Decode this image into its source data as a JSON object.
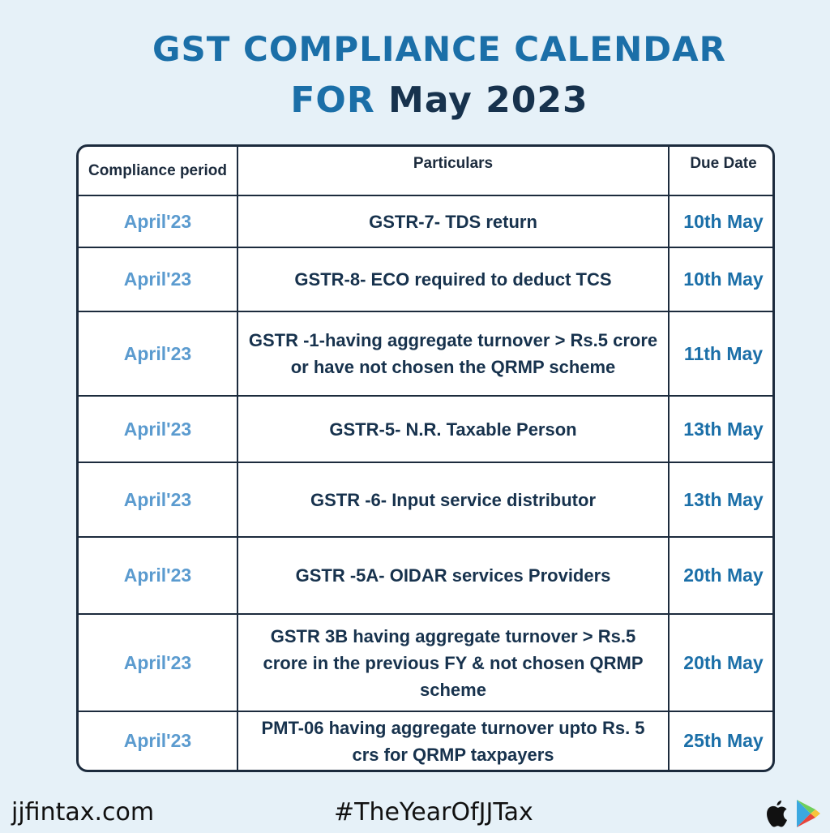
{
  "title": {
    "line1": "GST COMPLIANCE CALENDAR",
    "line2_prefix": "FOR",
    "line2_month": "May 2023"
  },
  "table": {
    "headers": {
      "period": "Compliance period",
      "particulars": "Particulars",
      "due_date": "Due Date"
    },
    "rows": [
      {
        "period": "April'23",
        "particulars": "GSTR-7- TDS return",
        "due": "10th May"
      },
      {
        "period": "April'23",
        "particulars": "GSTR-8- ECO required to deduct TCS",
        "due": "10th May"
      },
      {
        "period": "April'23",
        "particulars": "GSTR -1-having aggregate turnover > Rs.5 crore or have not chosen the QRMP scheme",
        "due": "11th May"
      },
      {
        "period": "April'23",
        "particulars": "GSTR-5- N.R. Taxable Person",
        "due": "13th May"
      },
      {
        "period": "April'23",
        "particulars": "GSTR -6- Input service distributor",
        "due": "13th May"
      },
      {
        "period": "April'23",
        "particulars": "GSTR -5A- OIDAR services Providers",
        "due": "20th May"
      },
      {
        "period": "April'23",
        "particulars": "GSTR 3B having aggregate turnover > Rs.5 crore in the previous FY & not chosen QRMP scheme",
        "due": "20th May"
      },
      {
        "period": "April'23",
        "particulars": "PMT-06 having aggregate turnover upto Rs. 5 crs for QRMP taxpayers",
        "due": "25th May"
      }
    ]
  },
  "footer": {
    "website": "jjfintax.com",
    "hashtag": "#TheYearOfJJTax",
    "icons": [
      "apple-icon",
      "google-play-icon"
    ]
  },
  "colors": {
    "background": "#e6f1f8",
    "title_blue": "#1b6fa8",
    "navy": "#17324d",
    "period_blue": "#5b9bcf"
  }
}
